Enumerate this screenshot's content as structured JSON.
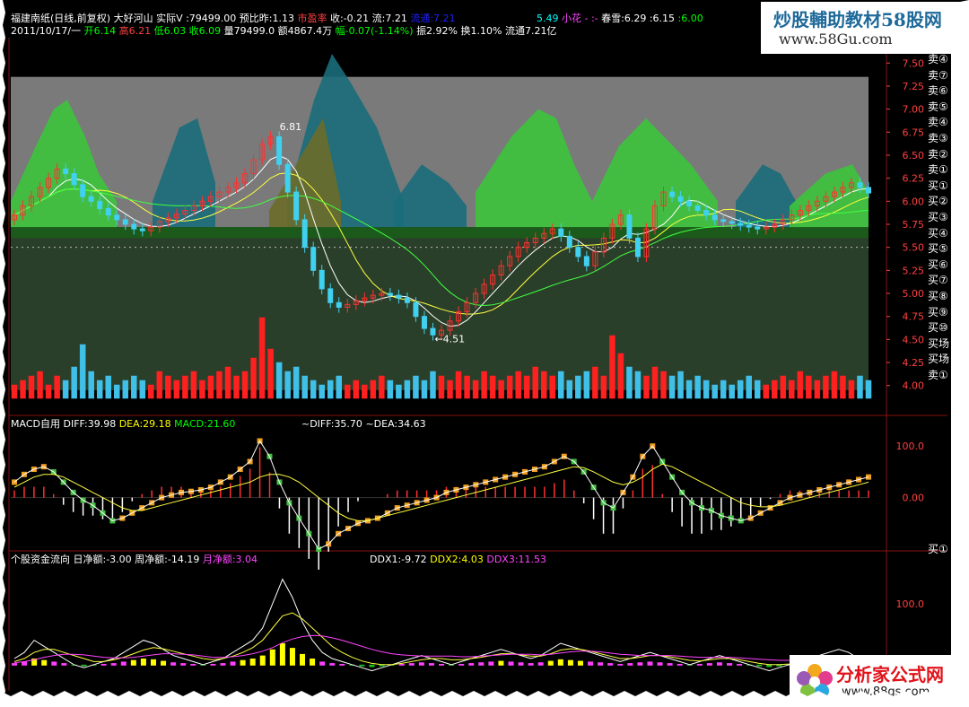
{
  "header": {
    "line1": [
      {
        "text": "福建南纸(日线,前复权) 大好河山 实际V :79499.00 预比昨:1.13 ",
        "color": "#ffffff"
      },
      {
        "text": "市盈率",
        "color": "#ff4040"
      },
      {
        "text": "  收:-0.21  流:7.21  ",
        "color": "#ffffff"
      },
      {
        "text": "流通:7.21",
        "color": "#2020ff"
      }
    ],
    "line1b": [
      {
        "text": "5.49",
        "color": "#00ffff"
      },
      {
        "text": " 小花 - :-",
        "color": "#ff44ff"
      },
      {
        "text": "     春雪:6.29",
        "color": "#ffffff"
      },
      {
        "text": "     :6.15 ",
        "color": "#ffffff"
      },
      {
        "text": ":6.00",
        "color": "#00ff00"
      }
    ],
    "line2": [
      {
        "text": "2011/10/17/一 ",
        "color": "#ffffff"
      },
      {
        "text": "开6.14 ",
        "color": "#00ff00"
      },
      {
        "text": "高6.21 ",
        "color": "#ff4040"
      },
      {
        "text": "低6.03 ",
        "color": "#00ff00"
      },
      {
        "text": "收6.09 ",
        "color": "#00ff00"
      },
      {
        "text": "量79499.0 额4867.4万 ",
        "color": "#ffffff"
      },
      {
        "text": "幅-0.07(-1.14%) ",
        "color": "#00ff00"
      },
      {
        "text": "振2.92% 换1.10% 流通7.21亿",
        "color": "#ffffff"
      }
    ]
  },
  "branding": {
    "top_line1": "炒股輔助教材58股网",
    "top_line2": "www.58Gu.com",
    "bottom_line1": "分析家公式网",
    "bottom_line2": "www.88gs.com"
  },
  "sidebar_signals": [
    "卖④",
    "卖⑦",
    "卖⑥",
    "卖⑤",
    "卖④",
    "卖③",
    "卖②",
    "卖①",
    "买①",
    "买②",
    "买③",
    "买④",
    "买⑤",
    "买⑥",
    "买⑦",
    "买⑧",
    "买⑨",
    "买⑩",
    "买场",
    "买场",
    "卖①"
  ],
  "macd_panel": {
    "title": "MACD自用",
    "readouts": [
      {
        "text": "DIFF:39.98",
        "color": "#ffffff"
      },
      {
        "text": "DEA:29.18",
        "color": "#ffff00"
      },
      {
        "text": "MACD:21.60",
        "color": "#00ff00"
      },
      {
        "text": "~DIFF:35.70",
        "color": "#ffffff"
      },
      {
        "text": "~DEA:34.63",
        "color": "#ffffff"
      }
    ],
    "right_signal": "买①"
  },
  "ddx_panel": {
    "title": "个股资金流向",
    "readouts": [
      {
        "text": "日净额:-3.00",
        "color": "#ffffff"
      },
      {
        "text": "周净额:-14.19",
        "color": "#ffffff"
      },
      {
        "text": "月净额:3.04",
        "color": "#ff44ff"
      },
      {
        "text": "DDX1:-9.72",
        "color": "#ffffff"
      },
      {
        "text": "DDX2:4.03",
        "color": "#ffff00"
      },
      {
        "text": "DDX3:11.53",
        "color": "#ff44ff"
      }
    ]
  },
  "chart_data": [
    {
      "type": "candlestick",
      "title": "福建南纸(日线,前复权)",
      "ylim": [
        3.9,
        7.6
      ],
      "y_ticks": [
        "4.00",
        "4.25",
        "4.50",
        "4.75",
        "5.00",
        "5.25",
        "5.50",
        "5.75",
        "6.00",
        "6.25",
        "6.50",
        "6.75",
        "7.00",
        "7.25",
        "7.50"
      ],
      "annotations": [
        {
          "text": "6.81",
          "kind": "high"
        },
        {
          "text": "←4.51",
          "kind": "low"
        }
      ],
      "close": [
        5.85,
        5.95,
        6.05,
        6.15,
        6.25,
        6.35,
        6.3,
        6.18,
        6.05,
        6.0,
        5.92,
        5.85,
        5.8,
        5.75,
        5.7,
        5.68,
        5.72,
        5.78,
        5.82,
        5.86,
        5.9,
        5.95,
        6.0,
        6.05,
        6.1,
        6.15,
        6.2,
        6.3,
        6.45,
        6.62,
        6.7,
        6.4,
        6.1,
        5.8,
        5.5,
        5.25,
        5.05,
        4.9,
        4.85,
        4.88,
        4.92,
        4.95,
        4.98,
        5.0,
        4.98,
        4.95,
        4.9,
        4.75,
        4.62,
        4.55,
        4.6,
        4.7,
        4.8,
        4.9,
        5.0,
        5.1,
        5.2,
        5.3,
        5.4,
        5.5,
        5.55,
        5.6,
        5.65,
        5.7,
        5.62,
        5.5,
        5.4,
        5.3,
        5.45,
        5.6,
        5.75,
        5.85,
        5.6,
        5.4,
        5.7,
        5.95,
        6.1,
        6.05,
        6.0,
        5.95,
        5.9,
        5.85,
        5.8,
        5.78,
        5.76,
        5.74,
        5.72,
        5.7,
        5.72,
        5.75,
        5.8,
        5.85,
        5.9,
        5.95,
        6.0,
        6.05,
        6.1,
        6.15,
        6.2,
        6.15,
        6.09
      ],
      "colors": {
        "up": "#ff3030",
        "down": "#40d0f0",
        "ma_white": "#ffffff",
        "ma_yellow": "#ffff40",
        "ma_green": "#40ff40"
      }
    },
    {
      "type": "bar",
      "title": "volume",
      "volumes": [
        3,
        4,
        5,
        6,
        3,
        5,
        4,
        7,
        12,
        6,
        4,
        5,
        3,
        4,
        5,
        4,
        3,
        6,
        5,
        4,
        5,
        6,
        4,
        5,
        6,
        7,
        5,
        6,
        9,
        18,
        11,
        8,
        6,
        7,
        5,
        4,
        3,
        4,
        5,
        3,
        4,
        3,
        4,
        5,
        4,
        3,
        4,
        5,
        4,
        6,
        5,
        4,
        6,
        5,
        4,
        6,
        5,
        4,
        5,
        6,
        5,
        7,
        6,
        5,
        6,
        4,
        5,
        6,
        7,
        5,
        14,
        10,
        7,
        6,
        5,
        7,
        6,
        5,
        6,
        4,
        5,
        4,
        3,
        4,
        3,
        4,
        5,
        4,
        3,
        4,
        5,
        4,
        6,
        5,
        4,
        5,
        6,
        5,
        4,
        5,
        4
      ]
    },
    {
      "type": "line",
      "title": "MACD自用",
      "y_ticks": [
        "100.0",
        "0.00"
      ],
      "ylim": [
        -100,
        130
      ],
      "series": [
        {
          "name": "DIFF",
          "values": [
            30,
            45,
            55,
            60,
            50,
            30,
            10,
            -5,
            -15,
            -30,
            -45,
            -40,
            -30,
            -20,
            -10,
            0,
            5,
            10,
            12,
            15,
            20,
            30,
            40,
            55,
            70,
            110,
            80,
            30,
            -10,
            -40,
            -70,
            -100,
            -90,
            -70,
            -60,
            -50,
            -45,
            -40,
            -30,
            -20,
            -15,
            -10,
            -5,
            0,
            10,
            15,
            20,
            25,
            30,
            35,
            40,
            45,
            50,
            55,
            60,
            70,
            80,
            70,
            50,
            20,
            -10,
            -20,
            10,
            40,
            80,
            100,
            70,
            40,
            10,
            -10,
            -20,
            -25,
            -35,
            -40,
            -45,
            -40,
            -30,
            -20,
            -10,
            0,
            5,
            10,
            15,
            20,
            25,
            30,
            35,
            40
          ]
        },
        {
          "name": "DEA",
          "values": [
            20,
            30,
            40,
            45,
            45,
            40,
            30,
            20,
            10,
            0,
            -10,
            -20,
            -25,
            -25,
            -20,
            -15,
            -10,
            -5,
            0,
            5,
            10,
            15,
            20,
            25,
            30,
            40,
            45,
            45,
            40,
            30,
            15,
            0,
            -15,
            -30,
            -40,
            -45,
            -45,
            -40,
            -35,
            -30,
            -25,
            -20,
            -15,
            -10,
            -5,
            0,
            5,
            10,
            15,
            20,
            25,
            30,
            35,
            40,
            45,
            50,
            55,
            60,
            58,
            50,
            40,
            30,
            25,
            30,
            40,
            55,
            65,
            60,
            50,
            40,
            30,
            20,
            10,
            0,
            -10,
            -15,
            -18,
            -18,
            -15,
            -10,
            -5,
            0,
            5,
            10,
            15,
            20,
            25,
            30
          ]
        }
      ]
    },
    {
      "type": "line",
      "title": "个股资金流向",
      "y_ticks": [
        "100.0",
        "0.00"
      ],
      "ylim": [
        -40,
        160
      ],
      "series": [
        {
          "name": "DDX1",
          "values": [
            10,
            20,
            40,
            30,
            20,
            10,
            0,
            -5,
            0,
            5,
            10,
            20,
            30,
            40,
            35,
            25,
            15,
            10,
            5,
            0,
            5,
            10,
            20,
            30,
            40,
            60,
            100,
            140,
            110,
            70,
            40,
            20,
            10,
            5,
            0,
            -5,
            -10,
            -5,
            0,
            5,
            10,
            15,
            10,
            5,
            0,
            5,
            10,
            15,
            20,
            25,
            20,
            15,
            10,
            15,
            25,
            35,
            30,
            25,
            20,
            15,
            10,
            5,
            10,
            15,
            20,
            15,
            10,
            5,
            0,
            5,
            10,
            15,
            10,
            5,
            0,
            -5,
            -10,
            -5,
            0,
            5,
            10,
            15,
            20,
            25,
            20,
            10,
            5
          ]
        },
        {
          "name": "DDX2",
          "values": [
            5,
            10,
            20,
            25,
            25,
            20,
            15,
            10,
            5,
            5,
            8,
            12,
            18,
            24,
            28,
            26,
            22,
            18,
            14,
            10,
            8,
            10,
            14,
            20,
            28,
            40,
            60,
            80,
            85,
            75,
            60,
            45,
            30,
            20,
            12,
            6,
            2,
            0,
            0,
            2,
            5,
            8,
            10,
            10,
            8,
            8,
            10,
            12,
            15,
            18,
            18,
            16,
            14,
            14,
            18,
            24,
            26,
            25,
            22,
            18,
            14,
            10,
            10,
            12,
            15,
            15,
            13,
            10,
            7,
            6,
            8,
            10,
            10,
            8,
            5,
            2,
            0,
            0,
            1,
            3,
            6,
            9,
            12,
            15,
            15,
            12,
            9
          ]
        },
        {
          "name": "DDX3",
          "values": [
            3,
            5,
            8,
            12,
            15,
            17,
            17,
            16,
            14,
            12,
            11,
            11,
            12,
            14,
            16,
            18,
            18,
            17,
            16,
            14,
            12,
            12,
            13,
            15,
            18,
            22,
            28,
            36,
            42,
            46,
            48,
            47,
            44,
            40,
            35,
            30,
            25,
            21,
            18,
            16,
            15,
            14,
            14,
            14,
            14,
            13,
            13,
            14,
            15,
            16,
            17,
            17,
            17,
            16,
            17,
            19,
            21,
            22,
            22,
            21,
            19,
            17,
            16,
            15,
            15,
            15,
            15,
            14,
            13,
            12,
            12,
            12,
            12,
            11,
            10,
            9,
            8,
            7,
            7,
            7,
            8,
            9,
            10,
            11,
            12,
            12,
            11
          ]
        }
      ]
    }
  ]
}
